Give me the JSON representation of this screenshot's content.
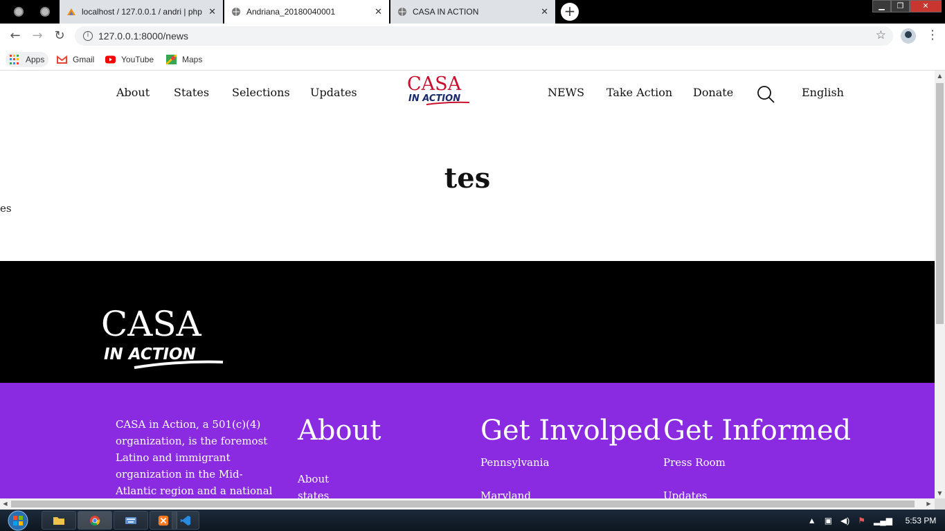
{
  "browser": {
    "tabs": [
      {
        "label": "localhost / 127.0.0.1 / andri | php",
        "active": false
      },
      {
        "label": "Andriana_20180040001",
        "active": true
      },
      {
        "label": "CASA IN ACTION",
        "active": false
      }
    ],
    "new_tab_label": "+",
    "url": "127.0.0.1:8000/news",
    "bookmarks": [
      {
        "label": "Apps",
        "icon": "apps-grid-icon"
      },
      {
        "label": "Gmail",
        "icon": "gmail-icon"
      },
      {
        "label": "YouTube",
        "icon": "youtube-icon"
      },
      {
        "label": "Maps",
        "icon": "maps-icon"
      }
    ]
  },
  "site": {
    "nav_left": [
      "About",
      "States",
      "Selections",
      "Updates"
    ],
    "nav_right": [
      "NEWS",
      "Take Action",
      "Donate"
    ],
    "language": "English",
    "logo": {
      "line1": "CASA",
      "line2": "IN ACTION"
    },
    "colors": {
      "brand_red": "#c8102e",
      "brand_blue": "#1a2a6c",
      "footer_purple": "#8a2be2"
    }
  },
  "page": {
    "title": "tes",
    "body": "tes"
  },
  "footer": {
    "description": "CASA in Action, a 501(c)(4) organization, is the foremost Latino and immigrant organization in the Mid-Atlantic region and a national leader in",
    "about": {
      "heading": "About",
      "links": [
        "About",
        "states"
      ]
    },
    "get_involved": {
      "heading": "Get Involped",
      "links": [
        "Pennsylvania",
        "Maryland"
      ]
    },
    "get_informed": {
      "heading": "Get Informed",
      "links": [
        "Press Room",
        "Updates"
      ]
    }
  },
  "taskbar": {
    "clock": "5:53 PM"
  }
}
